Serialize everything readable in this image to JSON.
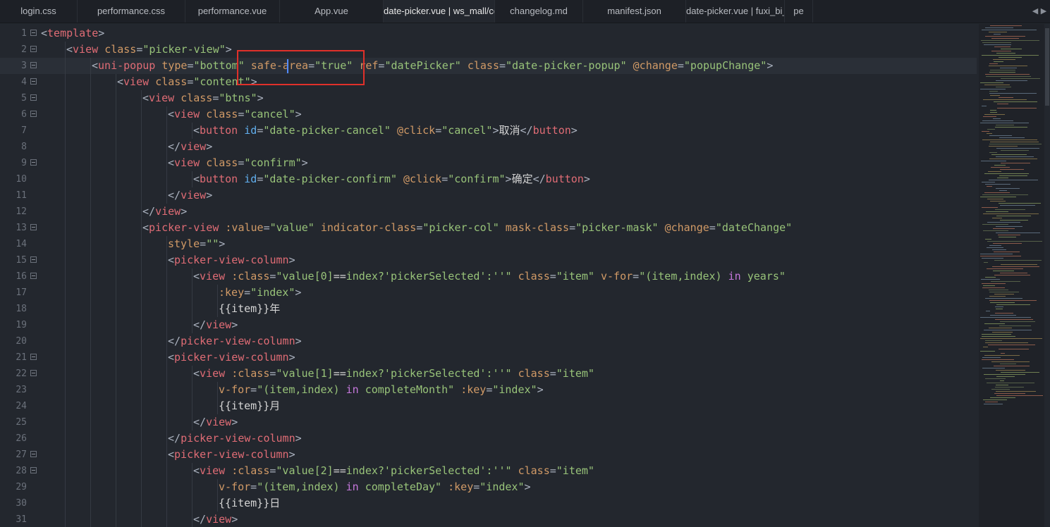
{
  "tabs": [
    {
      "label": "login.css",
      "active": false
    },
    {
      "label": "performance.css",
      "active": false
    },
    {
      "label": "performance.vue",
      "active": false
    },
    {
      "label": "App.vue",
      "active": false
    },
    {
      "label": "date-picker.vue | ws_mall/co......ate-picker",
      "active": true
    },
    {
      "label": "changelog.md",
      "active": false
    },
    {
      "label": "manifest.json",
      "active": false
    },
    {
      "label": "date-picker.vue | fuxi_bi_we......ate-picker",
      "active": false
    },
    {
      "label": "pe",
      "active": false
    }
  ],
  "tab_arrows": "◀ ▶",
  "colors": {
    "background": "#23272e",
    "tag": "#e06c75",
    "attribute": "#d19a66",
    "string": "#98c379",
    "highlight_box": "#e0302a"
  },
  "editor": {
    "lines": [
      {
        "n": "1",
        "fold": true,
        "indent": 0,
        "tokens": [
          [
            "p",
            "<"
          ],
          [
            "tag",
            "template"
          ],
          [
            "p",
            ">"
          ]
        ]
      },
      {
        "n": "2",
        "fold": true,
        "indent": 1,
        "tokens": [
          [
            "p",
            "<"
          ],
          [
            "tag",
            "view"
          ],
          [
            "t",
            " "
          ],
          [
            "attr",
            "class"
          ],
          [
            "p",
            "="
          ],
          [
            "str",
            "\"picker-view\""
          ],
          [
            "p",
            ">"
          ]
        ]
      },
      {
        "n": "3",
        "fold": true,
        "indent": 2,
        "tokens": [
          [
            "p",
            "<"
          ],
          [
            "tag",
            "uni-popup"
          ],
          [
            "t",
            " "
          ],
          [
            "attr",
            "type"
          ],
          [
            "p",
            "="
          ],
          [
            "str",
            "\"bottom\""
          ],
          [
            "t",
            " "
          ],
          [
            "attr",
            "safe-area"
          ],
          [
            "p",
            "="
          ],
          [
            "str",
            "\"true\""
          ],
          [
            "t",
            " "
          ],
          [
            "attr",
            "ref"
          ],
          [
            "p",
            "="
          ],
          [
            "str",
            "\"datePicker\""
          ],
          [
            "t",
            " "
          ],
          [
            "attr",
            "class"
          ],
          [
            "p",
            "="
          ],
          [
            "str",
            "\"date-picker-popup\""
          ],
          [
            "t",
            " "
          ],
          [
            "attr",
            "@change"
          ],
          [
            "p",
            "="
          ],
          [
            "str",
            "\"popupChange\""
          ],
          [
            "p",
            ">"
          ]
        ]
      },
      {
        "n": "4",
        "fold": true,
        "indent": 3,
        "tokens": [
          [
            "p",
            "<"
          ],
          [
            "tag",
            "view"
          ],
          [
            "t",
            " "
          ],
          [
            "attr",
            "class"
          ],
          [
            "p",
            "="
          ],
          [
            "str",
            "\"content\""
          ],
          [
            "p",
            ">"
          ]
        ]
      },
      {
        "n": "5",
        "fold": true,
        "indent": 4,
        "tokens": [
          [
            "p",
            "<"
          ],
          [
            "tag",
            "view"
          ],
          [
            "t",
            " "
          ],
          [
            "attr",
            "class"
          ],
          [
            "p",
            "="
          ],
          [
            "str",
            "\"btns\""
          ],
          [
            "p",
            ">"
          ]
        ]
      },
      {
        "n": "6",
        "fold": true,
        "indent": 5,
        "tokens": [
          [
            "p",
            "<"
          ],
          [
            "tag",
            "view"
          ],
          [
            "t",
            " "
          ],
          [
            "attr",
            "class"
          ],
          [
            "p",
            "="
          ],
          [
            "str",
            "\"cancel\""
          ],
          [
            "p",
            ">"
          ]
        ]
      },
      {
        "n": "7",
        "fold": false,
        "indent": 6,
        "tokens": [
          [
            "p",
            "<"
          ],
          [
            "tag",
            "button"
          ],
          [
            "t",
            " "
          ],
          [
            "id",
            "id"
          ],
          [
            "p",
            "="
          ],
          [
            "str",
            "\"date-picker-cancel\""
          ],
          [
            "t",
            " "
          ],
          [
            "attr",
            "@click"
          ],
          [
            "p",
            "="
          ],
          [
            "str",
            "\"cancel\""
          ],
          [
            "p",
            ">"
          ],
          [
            "t",
            "取消"
          ],
          [
            "p",
            "</"
          ],
          [
            "tag",
            "button"
          ],
          [
            "p",
            ">"
          ]
        ]
      },
      {
        "n": "8",
        "fold": false,
        "indent": 5,
        "tokens": [
          [
            "p",
            "</"
          ],
          [
            "tag",
            "view"
          ],
          [
            "p",
            ">"
          ]
        ]
      },
      {
        "n": "9",
        "fold": true,
        "indent": 5,
        "tokens": [
          [
            "p",
            "<"
          ],
          [
            "tag",
            "view"
          ],
          [
            "t",
            " "
          ],
          [
            "attr",
            "class"
          ],
          [
            "p",
            "="
          ],
          [
            "str",
            "\"confirm\""
          ],
          [
            "p",
            ">"
          ]
        ]
      },
      {
        "n": "10",
        "fold": false,
        "indent": 6,
        "tokens": [
          [
            "p",
            "<"
          ],
          [
            "tag",
            "button"
          ],
          [
            "t",
            " "
          ],
          [
            "id",
            "id"
          ],
          [
            "p",
            "="
          ],
          [
            "str",
            "\"date-picker-confirm\""
          ],
          [
            "t",
            " "
          ],
          [
            "attr",
            "@click"
          ],
          [
            "p",
            "="
          ],
          [
            "str",
            "\"confirm\""
          ],
          [
            "p",
            ">"
          ],
          [
            "t",
            "确定"
          ],
          [
            "p",
            "</"
          ],
          [
            "tag",
            "button"
          ],
          [
            "p",
            ">"
          ]
        ]
      },
      {
        "n": "11",
        "fold": false,
        "indent": 5,
        "tokens": [
          [
            "p",
            "</"
          ],
          [
            "tag",
            "view"
          ],
          [
            "p",
            ">"
          ]
        ]
      },
      {
        "n": "12",
        "fold": false,
        "indent": 4,
        "tokens": [
          [
            "p",
            "</"
          ],
          [
            "tag",
            "view"
          ],
          [
            "p",
            ">"
          ]
        ]
      },
      {
        "n": "13",
        "fold": true,
        "indent": 4,
        "tokens": [
          [
            "p",
            "<"
          ],
          [
            "tag",
            "picker-view"
          ],
          [
            "t",
            " "
          ],
          [
            "attr",
            ":value"
          ],
          [
            "p",
            "="
          ],
          [
            "str",
            "\"value\""
          ],
          [
            "t",
            " "
          ],
          [
            "attr",
            "indicator-class"
          ],
          [
            "p",
            "="
          ],
          [
            "str",
            "\"picker-col\""
          ],
          [
            "t",
            " "
          ],
          [
            "attr",
            "mask-class"
          ],
          [
            "p",
            "="
          ],
          [
            "str",
            "\"picker-mask\""
          ],
          [
            "t",
            " "
          ],
          [
            "attr",
            "@change"
          ],
          [
            "p",
            "="
          ],
          [
            "str",
            "\"dateChange\""
          ]
        ]
      },
      {
        "n": "14",
        "fold": false,
        "indent": 5,
        "tokens": [
          [
            "attr",
            "style"
          ],
          [
            "p",
            "="
          ],
          [
            "str",
            "\"\""
          ],
          [
            "p",
            ">"
          ]
        ]
      },
      {
        "n": "15",
        "fold": true,
        "indent": 5,
        "tokens": [
          [
            "p",
            "<"
          ],
          [
            "tag",
            "picker-view-column"
          ],
          [
            "p",
            ">"
          ]
        ]
      },
      {
        "n": "16",
        "fold": true,
        "indent": 6,
        "tokens": [
          [
            "p",
            "<"
          ],
          [
            "tag",
            "view"
          ],
          [
            "t",
            " "
          ],
          [
            "attr",
            ":class"
          ],
          [
            "p",
            "="
          ],
          [
            "str",
            "\"value[0]"
          ],
          [
            "t",
            "=="
          ],
          [
            "str",
            "index?'pickerSelected':''\""
          ],
          [
            "t",
            " "
          ],
          [
            "attr",
            "class"
          ],
          [
            "p",
            "="
          ],
          [
            "str",
            "\"item\""
          ],
          [
            "t",
            " "
          ],
          [
            "attr",
            "v-for"
          ],
          [
            "p",
            "="
          ],
          [
            "str",
            "\"(item,index) "
          ],
          [
            "kw",
            "in"
          ],
          [
            "str",
            " years\""
          ]
        ]
      },
      {
        "n": "17",
        "fold": false,
        "indent": 7,
        "tokens": [
          [
            "attr",
            ":key"
          ],
          [
            "p",
            "="
          ],
          [
            "str",
            "\"index\""
          ],
          [
            "p",
            ">"
          ]
        ]
      },
      {
        "n": "18",
        "fold": false,
        "indent": 7,
        "tokens": [
          [
            "t",
            "{{item}}年"
          ]
        ]
      },
      {
        "n": "19",
        "fold": false,
        "indent": 6,
        "tokens": [
          [
            "p",
            "</"
          ],
          [
            "tag",
            "view"
          ],
          [
            "p",
            ">"
          ]
        ]
      },
      {
        "n": "20",
        "fold": false,
        "indent": 5,
        "tokens": [
          [
            "p",
            "</"
          ],
          [
            "tag",
            "picker-view-column"
          ],
          [
            "p",
            ">"
          ]
        ]
      },
      {
        "n": "21",
        "fold": true,
        "indent": 5,
        "tokens": [
          [
            "p",
            "<"
          ],
          [
            "tag",
            "picker-view-column"
          ],
          [
            "p",
            ">"
          ]
        ]
      },
      {
        "n": "22",
        "fold": true,
        "indent": 6,
        "tokens": [
          [
            "p",
            "<"
          ],
          [
            "tag",
            "view"
          ],
          [
            "t",
            " "
          ],
          [
            "attr",
            ":class"
          ],
          [
            "p",
            "="
          ],
          [
            "str",
            "\"value[1]"
          ],
          [
            "t",
            "=="
          ],
          [
            "str",
            "index?'pickerSelected':''\""
          ],
          [
            "t",
            " "
          ],
          [
            "attr",
            "class"
          ],
          [
            "p",
            "="
          ],
          [
            "str",
            "\"item\""
          ]
        ]
      },
      {
        "n": "23",
        "fold": false,
        "indent": 7,
        "tokens": [
          [
            "attr",
            "v-for"
          ],
          [
            "p",
            "="
          ],
          [
            "str",
            "\"(item,index) "
          ],
          [
            "kw",
            "in"
          ],
          [
            "str",
            " completeMonth\""
          ],
          [
            "t",
            " "
          ],
          [
            "attr",
            ":key"
          ],
          [
            "p",
            "="
          ],
          [
            "str",
            "\"index\""
          ],
          [
            "p",
            ">"
          ]
        ]
      },
      {
        "n": "24",
        "fold": false,
        "indent": 7,
        "tokens": [
          [
            "t",
            "{{item}}月"
          ]
        ]
      },
      {
        "n": "25",
        "fold": false,
        "indent": 6,
        "tokens": [
          [
            "p",
            "</"
          ],
          [
            "tag",
            "view"
          ],
          [
            "p",
            ">"
          ]
        ]
      },
      {
        "n": "26",
        "fold": false,
        "indent": 5,
        "tokens": [
          [
            "p",
            "</"
          ],
          [
            "tag",
            "picker-view-column"
          ],
          [
            "p",
            ">"
          ]
        ]
      },
      {
        "n": "27",
        "fold": true,
        "indent": 5,
        "tokens": [
          [
            "p",
            "<"
          ],
          [
            "tag",
            "picker-view-column"
          ],
          [
            "p",
            ">"
          ]
        ]
      },
      {
        "n": "28",
        "fold": true,
        "indent": 6,
        "tokens": [
          [
            "p",
            "<"
          ],
          [
            "tag",
            "view"
          ],
          [
            "t",
            " "
          ],
          [
            "attr",
            ":class"
          ],
          [
            "p",
            "="
          ],
          [
            "str",
            "\"value[2]"
          ],
          [
            "t",
            "=="
          ],
          [
            "str",
            "index?'pickerSelected':''\""
          ],
          [
            "t",
            " "
          ],
          [
            "attr",
            "class"
          ],
          [
            "p",
            "="
          ],
          [
            "str",
            "\"item\""
          ]
        ]
      },
      {
        "n": "29",
        "fold": false,
        "indent": 7,
        "tokens": [
          [
            "attr",
            "v-for"
          ],
          [
            "p",
            "="
          ],
          [
            "str",
            "\"(item,index) "
          ],
          [
            "kw",
            "in"
          ],
          [
            "str",
            " completeDay\""
          ],
          [
            "t",
            " "
          ],
          [
            "attr",
            ":key"
          ],
          [
            "p",
            "="
          ],
          [
            "str",
            "\"index\""
          ],
          [
            "p",
            ">"
          ]
        ]
      },
      {
        "n": "30",
        "fold": false,
        "indent": 7,
        "tokens": [
          [
            "t",
            "{{item}}日"
          ]
        ]
      },
      {
        "n": "31",
        "fold": false,
        "indent": 6,
        "tokens": [
          [
            "p",
            "</"
          ],
          [
            "tag",
            "view"
          ],
          [
            "p",
            ">"
          ]
        ]
      }
    ]
  }
}
